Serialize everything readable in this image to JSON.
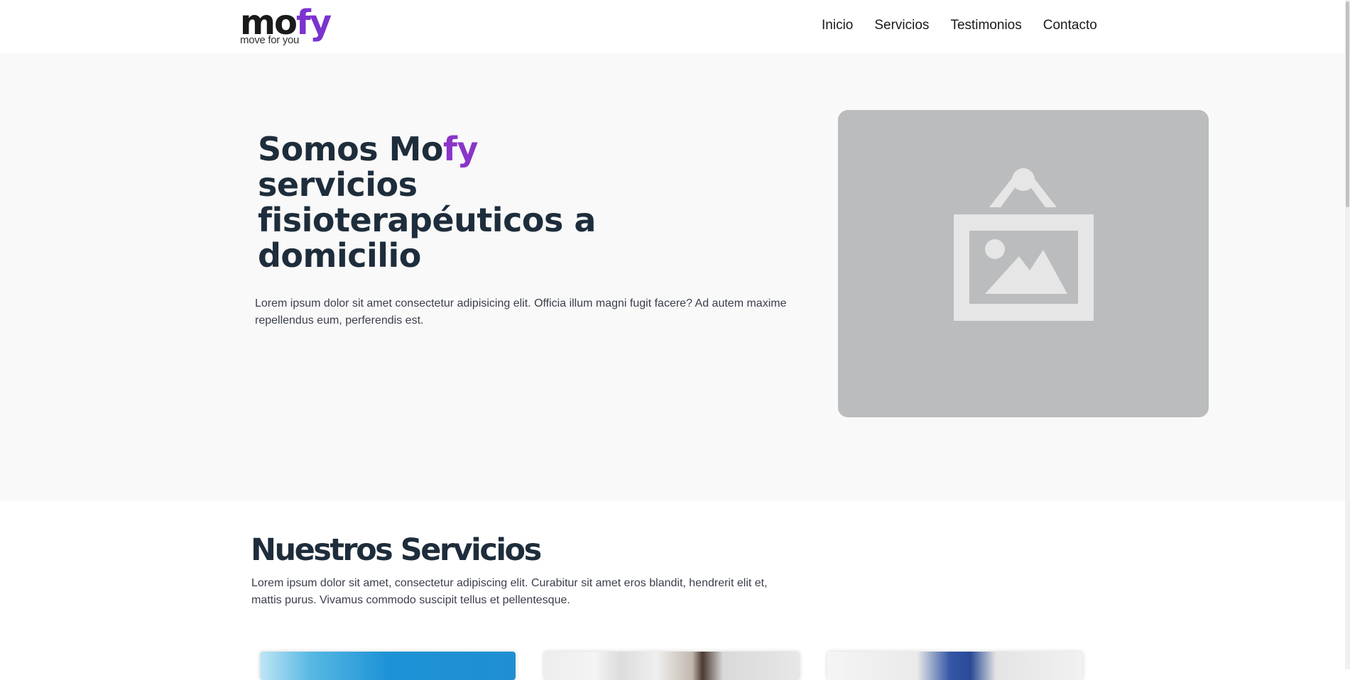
{
  "brand": {
    "logo_main": "mo",
    "logo_accent": "fy",
    "tagline": "move for you",
    "accent_color": "#8a35c9"
  },
  "nav": {
    "items": [
      "Inicio",
      "Servicios",
      "Testimonios",
      "Contacto"
    ]
  },
  "hero": {
    "title_part1": "Somos Mo",
    "title_accent": "fy",
    "title_rest": "servicios fisioterapéuticos a domicilio",
    "description": "Lorem ipsum dolor sit amet consectetur adipisicing elit. Officia illum magni fugit facere? Ad autem maxime repellendus eum, perferendis est.",
    "image_icon": "image-placeholder-icon"
  },
  "services": {
    "title": "Nuestros Servicios",
    "description": "Lorem ipsum dolor sit amet, consectetur adipiscing elit. Curabitur sit amet eros blandit, hendrerit elit et, mattis purus. Vivamus commodo suscipit tellus et pellentesque."
  },
  "colors": {
    "heading": "#1e2d3b",
    "body_text": "#3a3f4a",
    "hero_background": "#f9f9f9",
    "image_placeholder": "#bbbcbe"
  }
}
